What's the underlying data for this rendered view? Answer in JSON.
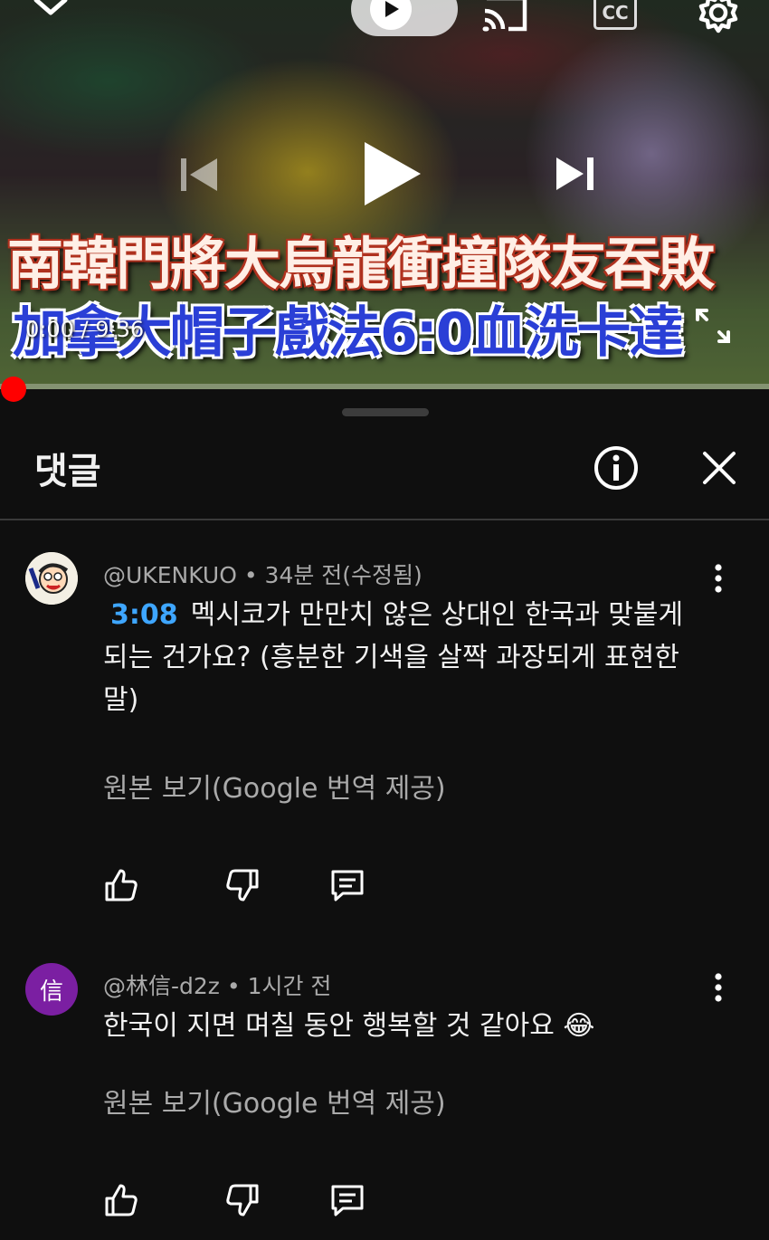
{
  "player": {
    "video_title_line1": "南韓門將大烏龍衝撞隊友吞敗",
    "video_title_line2": "加拿大帽子戲法6:0血洗卡達",
    "time_label": "0:00 / 9:36",
    "progress_fraction": 0.0,
    "icons": [
      "chevron-down-icon",
      "play-icon",
      "cast-icon",
      "captions-icon",
      "settings-icon",
      "previous-icon",
      "play-icon",
      "next-icon",
      "fullscreen-icon"
    ],
    "cc_label": "CC",
    "accent_color": "#ff0000"
  },
  "panel": {
    "title": "댓글",
    "info_icon": "info-icon",
    "close_icon": "close-icon"
  },
  "comments": [
    {
      "author": "@UKENKUO",
      "time": "34분 전(수정됨)",
      "timestamp_link": "3:08",
      "text": "멕시코가 만만치 않은 상대인 한국과 맞붙게 되는 건가요? (흥분한 기색을 살짝 과장되게 표현한 말)",
      "translate_link": "원본 보기(Google 번역 제공)",
      "avatar_type": "cartoon-image"
    },
    {
      "author": "@林信-d2z",
      "time": "1시간 전",
      "text": "한국이 지면 며칠 동안 행복할 것 같아요 😂",
      "translate_link": "원본 보기(Google 번역 제공)",
      "avatar_letter": "信",
      "avatar_color": "#7b1fa2"
    }
  ],
  "separator": "•",
  "comment_actions": [
    "thumbs-up-icon",
    "thumbs-down-icon",
    "reply-icon"
  ],
  "colors": {
    "background": "#0f0f0f",
    "link": "#3ea6ff",
    "secondary_text": "#aaaaaa"
  }
}
